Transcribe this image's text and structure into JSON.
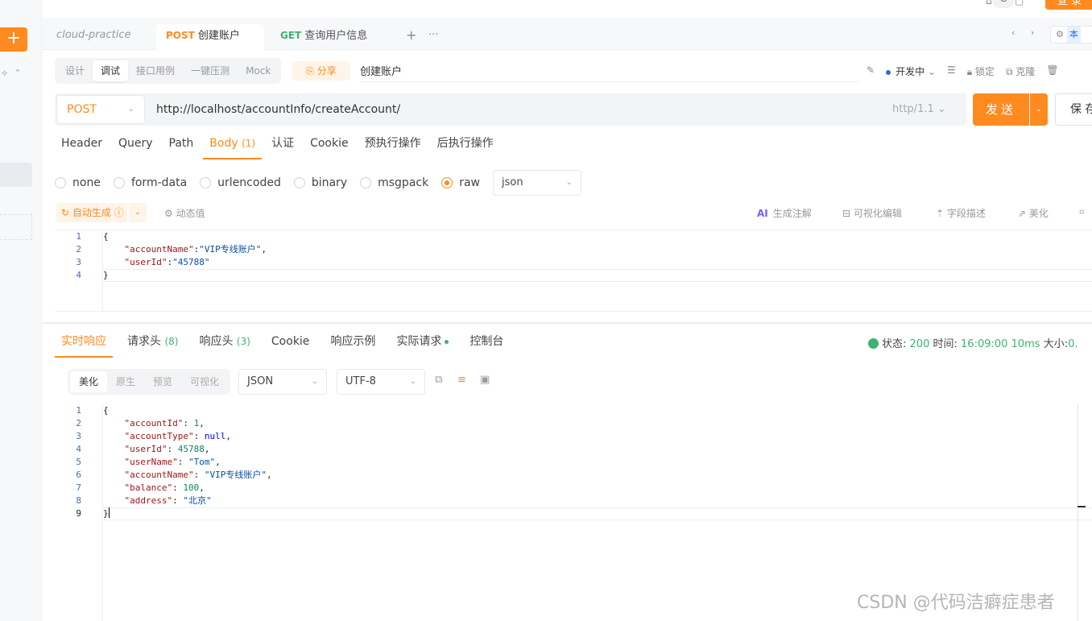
{
  "topbar": {
    "login_label": "登 录",
    "circle_label": "G"
  },
  "tabs": {
    "project": "cloud-practice",
    "active": {
      "method": "POST",
      "name": "创建账户"
    },
    "second": {
      "method": "GET",
      "name": "查询用户信息"
    },
    "add": "+",
    "more": "···",
    "env_label": "本"
  },
  "subtabs": [
    "设计",
    "调试",
    "接口用例",
    "一键压测",
    "Mock"
  ],
  "share_label": "分享",
  "api_name": "创建账户",
  "right_tools": {
    "status": "开发中",
    "lock": "锁定",
    "clone": "克隆"
  },
  "request": {
    "method": "POST",
    "url": "http://localhost/accountInfo/createAccount/",
    "http_version": "http/1.1",
    "send_label": "发送",
    "save_label": "保 存"
  },
  "param_tabs": [
    {
      "label": "Header",
      "count": ""
    },
    {
      "label": "Query",
      "count": ""
    },
    {
      "label": "Path",
      "count": ""
    },
    {
      "label": "Body",
      "count": "(1)"
    },
    {
      "label": "认证",
      "count": ""
    },
    {
      "label": "Cookie",
      "count": ""
    },
    {
      "label": "预执行操作",
      "count": ""
    },
    {
      "label": "后执行操作",
      "count": ""
    }
  ],
  "body_types": [
    "none",
    "form-data",
    "urlencoded",
    "binary",
    "msgpack",
    "raw"
  ],
  "body_format": "json",
  "body_toolbar": {
    "auto_gen": "自动生成",
    "dynamic": "动态值",
    "ai_comment": "生成注解",
    "visual_edit": "可视化编辑",
    "field_desc": "字段描述",
    "beautify": "美化"
  },
  "request_body": {
    "line_numbers": [
      "1",
      "2",
      "3",
      "4"
    ],
    "lines": [
      {
        "text": "{"
      },
      {
        "key": "\"accountName\"",
        "sep": ":",
        "val": "\"VIP专线账户\"",
        "end": ","
      },
      {
        "key": "\"userId\"",
        "sep": ":",
        "val": "\"45788\"",
        "end": ""
      },
      {
        "text": "}"
      }
    ]
  },
  "response_tabs": [
    {
      "label": "实时响应",
      "count": ""
    },
    {
      "label": "请求头",
      "count": "(8)"
    },
    {
      "label": "响应头",
      "count": "(3)"
    },
    {
      "label": "Cookie",
      "count": ""
    },
    {
      "label": "响应示例",
      "count": ""
    },
    {
      "label": "实际请求",
      "count": ""
    },
    {
      "label": "控制台",
      "count": ""
    }
  ],
  "response_status": {
    "status_label": "状态:",
    "status": "200",
    "time_label": "时间:",
    "time": "16:09:00",
    "duration": "10ms",
    "size_label": "大小:",
    "size": "0."
  },
  "view_tabs": [
    "美化",
    "原生",
    "预览",
    "可视化"
  ],
  "resp_format": "JSON",
  "resp_encoding": "UTF-8",
  "response_body": {
    "line_numbers": [
      "1",
      "2",
      "3",
      "4",
      "5",
      "6",
      "7",
      "8",
      "9"
    ],
    "lines": [
      {
        "text": "{"
      },
      {
        "key": "\"accountId\"",
        "sep": ": ",
        "val": "1",
        "end": ","
      },
      {
        "key": "\"accountType\"",
        "sep": ": ",
        "val": "null",
        "end": ","
      },
      {
        "key": "\"userId\"",
        "sep": ": ",
        "val": "45788",
        "end": ","
      },
      {
        "key": "\"userName\"",
        "sep": ": ",
        "val": "\"Tom\"",
        "end": ","
      },
      {
        "key": "\"accountName\"",
        "sep": ": ",
        "val": "\"VIP专线账户\"",
        "end": ","
      },
      {
        "key": "\"balance\"",
        "sep": ": ",
        "val": "100",
        "end": ","
      },
      {
        "key": "\"address\"",
        "sep": ": ",
        "val": "\"北京\"",
        "end": ""
      },
      {
        "text": "}"
      }
    ]
  },
  "watermark": "CSDN @代码洁癖症患者",
  "colors": {
    "accent": "#ff8a1f",
    "success": "#3cb371",
    "link": "#2f6bd8"
  }
}
